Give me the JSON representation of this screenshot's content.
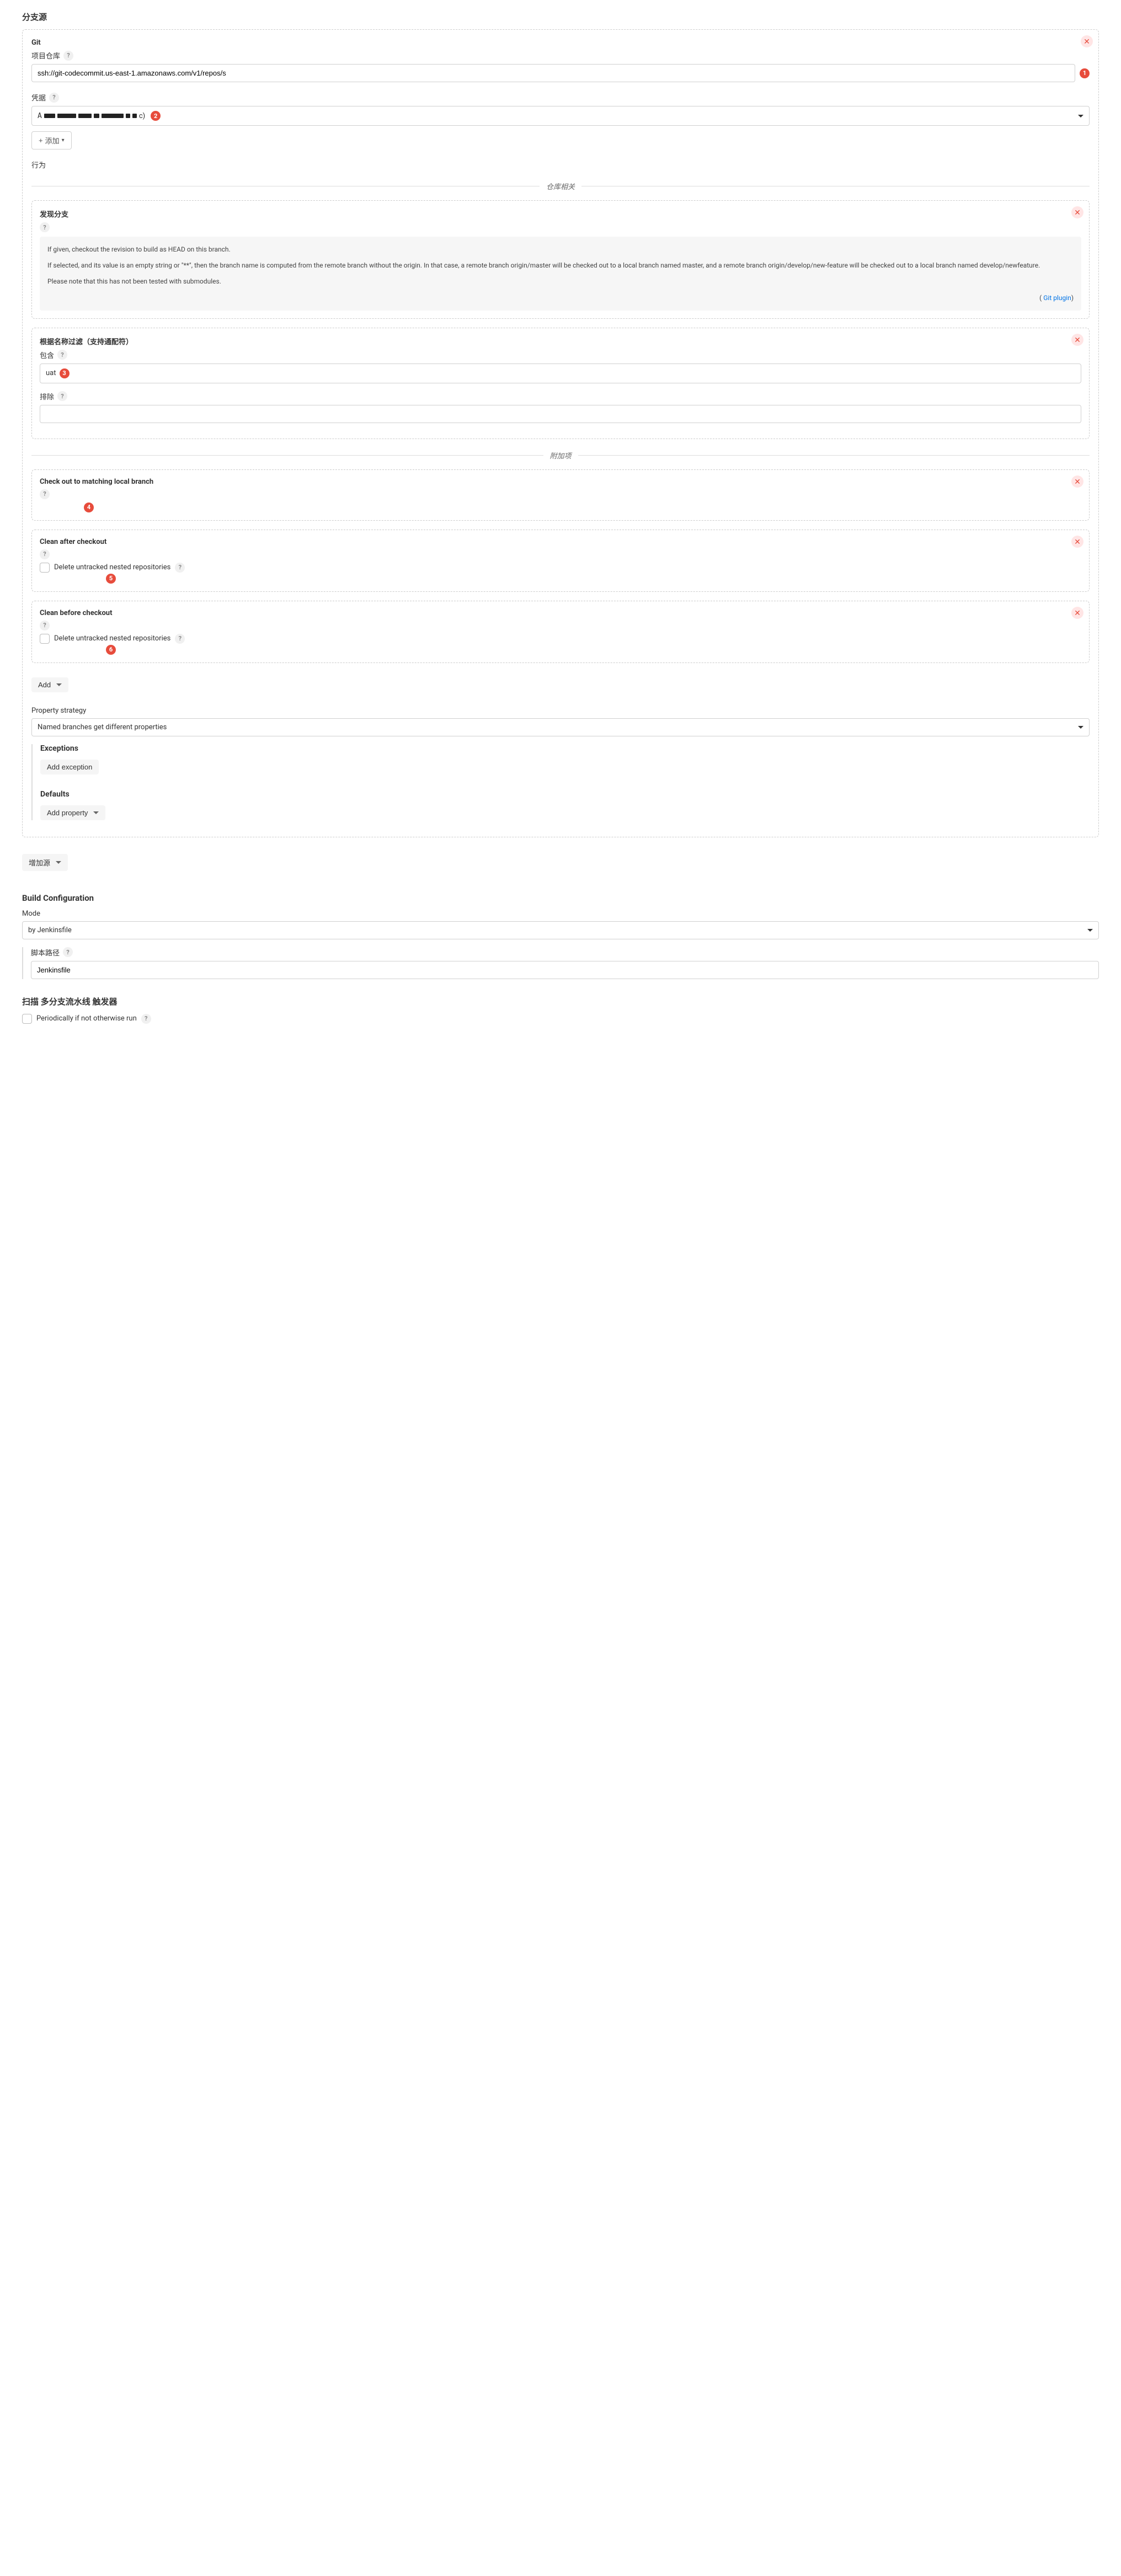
{
  "page": {
    "branch_sources_title": "分支源",
    "build_config_title": "Build Configuration",
    "scan_triggers_title": "扫描 多分支流水线 触发器"
  },
  "git": {
    "title": "Git",
    "repo_label": "项目仓库",
    "repo_value": "ssh://git-codecommit.us-east-1.amazonaws.com/v1/repos/s",
    "creds_label": "凭据",
    "creds_value_suffix": "c)",
    "add_button": "添加",
    "behavior_label": "行为",
    "divider_repo": "仓库相关",
    "divider_extra": "附加项"
  },
  "discover": {
    "title": "发现分支",
    "info_p1": "If given, checkout the revision to build as HEAD on this branch.",
    "info_p2": "If selected, and its value is an empty string or \"**\", then the branch name is computed from the remote branch without the origin. In that case, a remote branch origin/master will be checked out to a local branch named master, and a remote branch origin/develop/new-feature will be checked out to a local branch named develop/newfeature.",
    "info_p3": "Please note that this has not been tested with submodules.",
    "plugin_link": "Git plugin"
  },
  "filter": {
    "title": "根据名称过滤（支持通配符）",
    "include_label": "包含",
    "include_value": "uat",
    "exclude_label": "排除",
    "exclude_value": ""
  },
  "checkout_local": {
    "title": "Check out to matching local branch"
  },
  "clean_after": {
    "title": "Clean after checkout",
    "checkbox_label": "Delete untracked nested repositories"
  },
  "clean_before": {
    "title": "Clean before checkout",
    "checkbox_label": "Delete untracked nested repositories"
  },
  "add_button": "Add",
  "property_strategy": {
    "label": "Property strategy",
    "value": "Named branches get different properties",
    "exceptions_title": "Exceptions",
    "add_exception": "Add exception",
    "defaults_title": "Defaults",
    "add_property": "Add property"
  },
  "add_source": "增加源",
  "build_config": {
    "mode_label": "Mode",
    "mode_value": "by Jenkinsfile",
    "script_path_label": "脚本路径",
    "script_path_value": "Jenkinsfile"
  },
  "triggers": {
    "periodic_label": "Periodically if not otherwise run"
  },
  "badges": [
    "1",
    "2",
    "3",
    "4",
    "5",
    "6"
  ]
}
